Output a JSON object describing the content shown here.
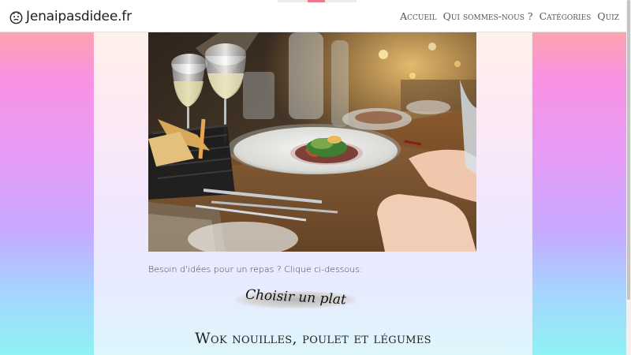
{
  "brand": {
    "name": "Jenaipasdidee.fr",
    "icon": "smiley-face-icon"
  },
  "nav": {
    "items": [
      {
        "label": "Accueil"
      },
      {
        "label": "Qui sommes-nous ?"
      },
      {
        "label": "Catégories"
      },
      {
        "label": "Quiz"
      }
    ]
  },
  "hero": {
    "subject": "restaurant-table-with-plated-dish-photo"
  },
  "intro_text": "Besoin d'idées pour un repas ? Clique ci-dessous:",
  "choose_button": {
    "label": "Choisir un plat"
  },
  "recipe": {
    "title": "Wok nouilles, poulet et légumes"
  },
  "colors": {
    "accent": "#e57b8c",
    "background_top": "#ffb08a",
    "background_mid": "#e59cf7",
    "background_bottom": "#8ff2f3"
  }
}
